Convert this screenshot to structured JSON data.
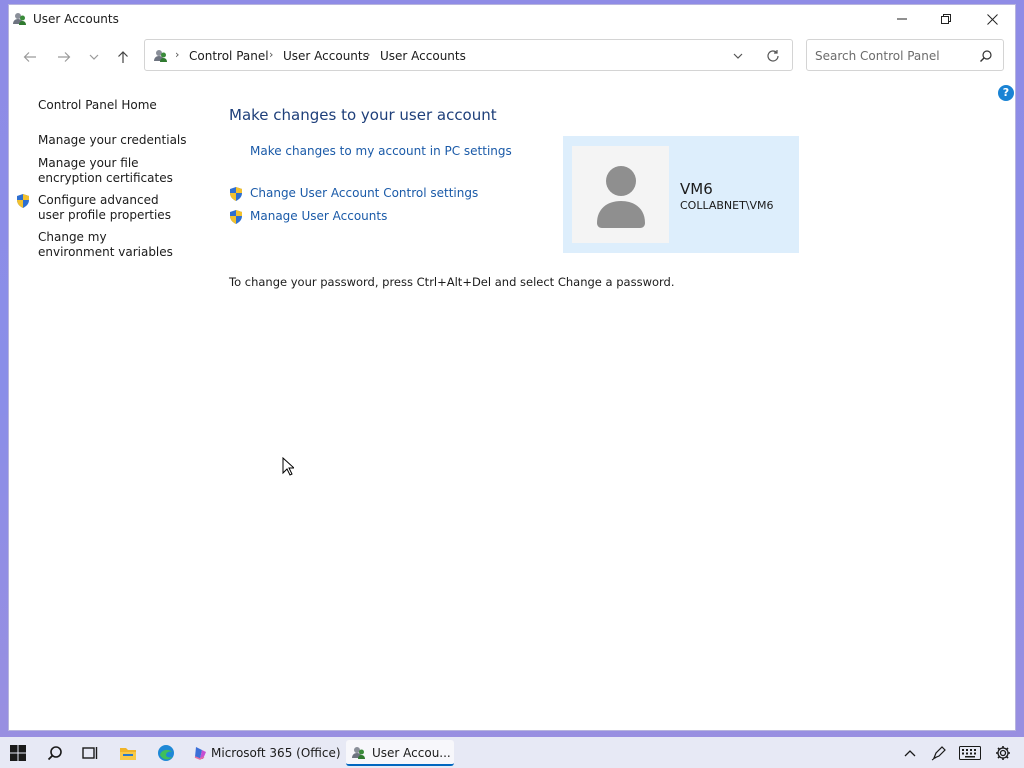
{
  "window": {
    "title": "User Accounts",
    "controls": {
      "minimize": "minimize",
      "restore": "restore",
      "close": "close"
    }
  },
  "toolbar": {
    "breadcrumb": [
      "Control Panel",
      "User Accounts",
      "User Accounts"
    ],
    "search_placeholder": "Search Control Panel"
  },
  "sidebar": {
    "home": "Control Panel Home",
    "links": [
      {
        "label": "Manage your credentials",
        "shield": false
      },
      {
        "label": "Manage your file encryption certificates",
        "shield": false
      },
      {
        "label": "Configure advanced user profile properties",
        "shield": true
      },
      {
        "label": "Change my environment variables",
        "shield": false
      }
    ]
  },
  "main": {
    "heading": "Make changes to your user account",
    "tasks": [
      {
        "label": "Make changes to my account in PC settings",
        "shield": false
      },
      {
        "label": "Change User Account Control settings",
        "shield": true
      },
      {
        "label": "Manage User Accounts",
        "shield": true
      }
    ],
    "account": {
      "name": "VM6",
      "domain_user": "COLLABNET\\VM6"
    },
    "password_note": "To change your password, press Ctrl+Alt+Del and select Change a password."
  },
  "taskbar": {
    "apps": [
      {
        "label": "Microsoft 365 (Office)",
        "active": false
      },
      {
        "label": "User Accou...",
        "active": true
      }
    ],
    "icons": [
      "start-icon",
      "search-icon",
      "task-view-icon",
      "file-explorer-icon",
      "edge-icon",
      "chevron-up-icon",
      "pen-icon",
      "keyboard-icon",
      "gear-icon"
    ]
  },
  "colors": {
    "link": "#1a5aa8",
    "heading": "#1e3f7a",
    "card": "#ddeefc",
    "help": "#1a83d4"
  }
}
